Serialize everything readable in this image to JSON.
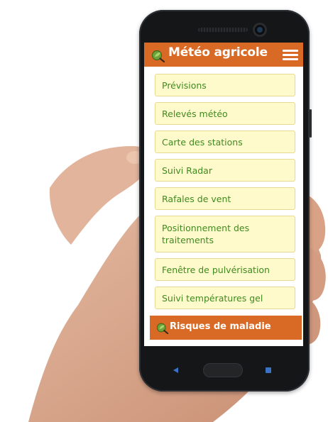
{
  "app": {
    "title": "Météo agricole",
    "accent_color": "#d96a25",
    "menu_bg_color": "#fffacb",
    "menu_text_color": "#3f8a1f"
  },
  "icons": {
    "logo": "leaf-magnifier-icon",
    "menu": "hamburger-menu-icon",
    "nav_back": "back-triangle-icon",
    "nav_home": "home-pill-icon",
    "nav_recent": "recent-square-icon"
  },
  "menu": {
    "items": [
      {
        "label": "Prévisions"
      },
      {
        "label": "Relevés météo"
      },
      {
        "label": "Carte des stations"
      },
      {
        "label": "Suivi Radar"
      },
      {
        "label": "Rafales de vent"
      },
      {
        "label": "Positionnement des traitements"
      },
      {
        "label": "Fenêtre de pulvérisation"
      },
      {
        "label": "Suivi températures gel"
      }
    ]
  },
  "section": {
    "label": "Risques de maladie"
  }
}
